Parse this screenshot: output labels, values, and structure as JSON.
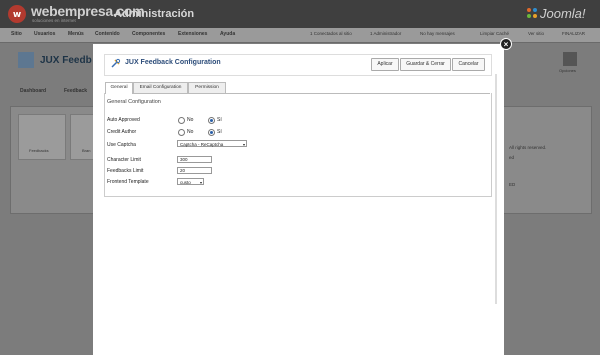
{
  "header": {
    "brand": "webempresa.com",
    "brand_tagline": "soluciones en internet",
    "admin_title": "Administración",
    "cms_logo": "Joomla!"
  },
  "menu": {
    "items": [
      "Sitio",
      "Usuarios",
      "Menús",
      "Contenido",
      "Componentes",
      "Extensiones",
      "Ayuda"
    ],
    "status": [
      "1 Conectados al sitio",
      "1 Administrador",
      "No hay mensajes",
      "Limpiar Caché",
      "Ver sitio",
      "FINALIZAR"
    ]
  },
  "background_page": {
    "title": "JUX Feedb",
    "right_icon_label": "Opciones",
    "tabs": [
      "Dashboard",
      "Feedback"
    ],
    "boxes": [
      "Feedbacks",
      "Bran"
    ],
    "side_texts": [
      "All rights reserved.",
      "ed",
      "ED"
    ]
  },
  "modal": {
    "title": "JUX Feedback Configuration",
    "buttons": {
      "apply": "Aplicar",
      "save_close": "Guardar & Cerrar",
      "cancel": "Cancelar"
    },
    "tabs": [
      "General",
      "Email Configuration",
      "Permission"
    ],
    "section_title": "General Configuration",
    "fields": {
      "auto_approved": {
        "label": "Auto Approved",
        "options": [
          "No",
          "Sí"
        ],
        "selected": "Sí"
      },
      "credit_author": {
        "label": "Credit Author",
        "options": [
          "No",
          "Sí"
        ],
        "selected": "Sí"
      },
      "use_captcha": {
        "label": "Use Captcha",
        "value": "Captcha - ReCaptcha"
      },
      "character_limit": {
        "label": "Character Limit",
        "value": "300"
      },
      "feedbacks_limit": {
        "label": "Feedbacks Limit",
        "value": "20"
      },
      "frontend_template": {
        "label": "Frontend Template",
        "value": "custo"
      }
    }
  },
  "icons": {
    "close": "close-icon",
    "joomla": "joomla-logo-icon",
    "webempresa": "webempresa-logo-icon",
    "feedback": "tools-icon"
  }
}
